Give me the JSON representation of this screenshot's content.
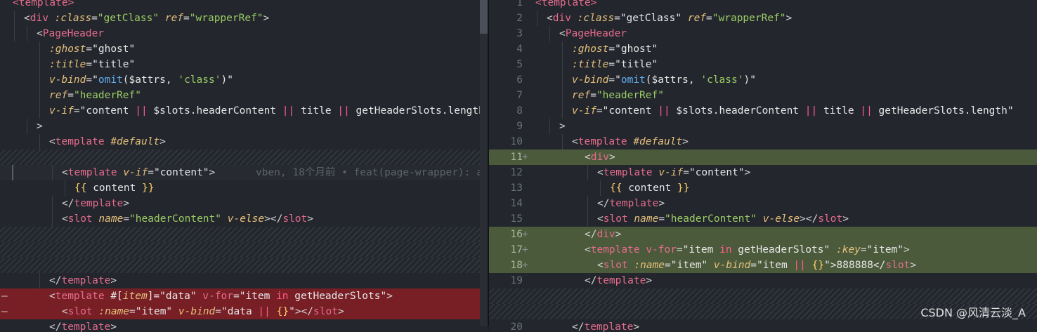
{
  "watermark": "CSDN @风清云淡_A",
  "left_blame": "vben, 18个月前 • feat(page-wrapper): a",
  "right_line_numbers": [
    "1",
    "2",
    "3",
    "4",
    "5",
    "6",
    "7",
    "8",
    "9",
    "10",
    "11",
    "12",
    "13",
    "14",
    "15",
    "16",
    "17",
    "18",
    "19",
    "",
    "",
    "20"
  ],
  "right_markers": {
    "11": "+",
    "16": "+",
    "17": "+",
    "18": "+"
  },
  "left_markers": {
    "del1": "—",
    "del2": "—"
  },
  "code": {
    "template_open": "<template>",
    "div_open": "<div :class=\"getClass\" ref=\"wrapperRef\">",
    "pageheader_open": "<PageHeader",
    "ghost": ":ghost=\"ghost\"",
    "title": ":title=\"title\"",
    "vbind": "v-bind=\"omit($attrs, 'class')\"",
    "ref": "ref=\"headerRef\"",
    "vif_left": "v-if=\"content || $slots.headerContent || title || getHeaderSlots.length",
    "vif_right": "v-if=\"content || $slots.headerContent || title || getHeaderSlots.length\"",
    "close_gt": ">",
    "template_default": "<template #default>",
    "div": "<div>",
    "template_vif": "<template v-if=\"content\">",
    "mustache": "{{ content }}",
    "template_close": "</template>",
    "slot_header": "<slot name=\"headerContent\" v-else></slot>",
    "div_close": "</div>",
    "template_vfor": "<template v-for=\"item in getHeaderSlots\" :key=\"item\">",
    "slot_item": "<slot :name=\"item\" v-bind=\"item || {}\">888888</slot>",
    "template_item": "<template #[item]=\"data\" v-for=\"item in getHeaderSlots\">",
    "slot_data": "<slot :name=\"item\" v-bind=\"data || {}\"></slot>",
    "template_close_partial": "</template>"
  }
}
